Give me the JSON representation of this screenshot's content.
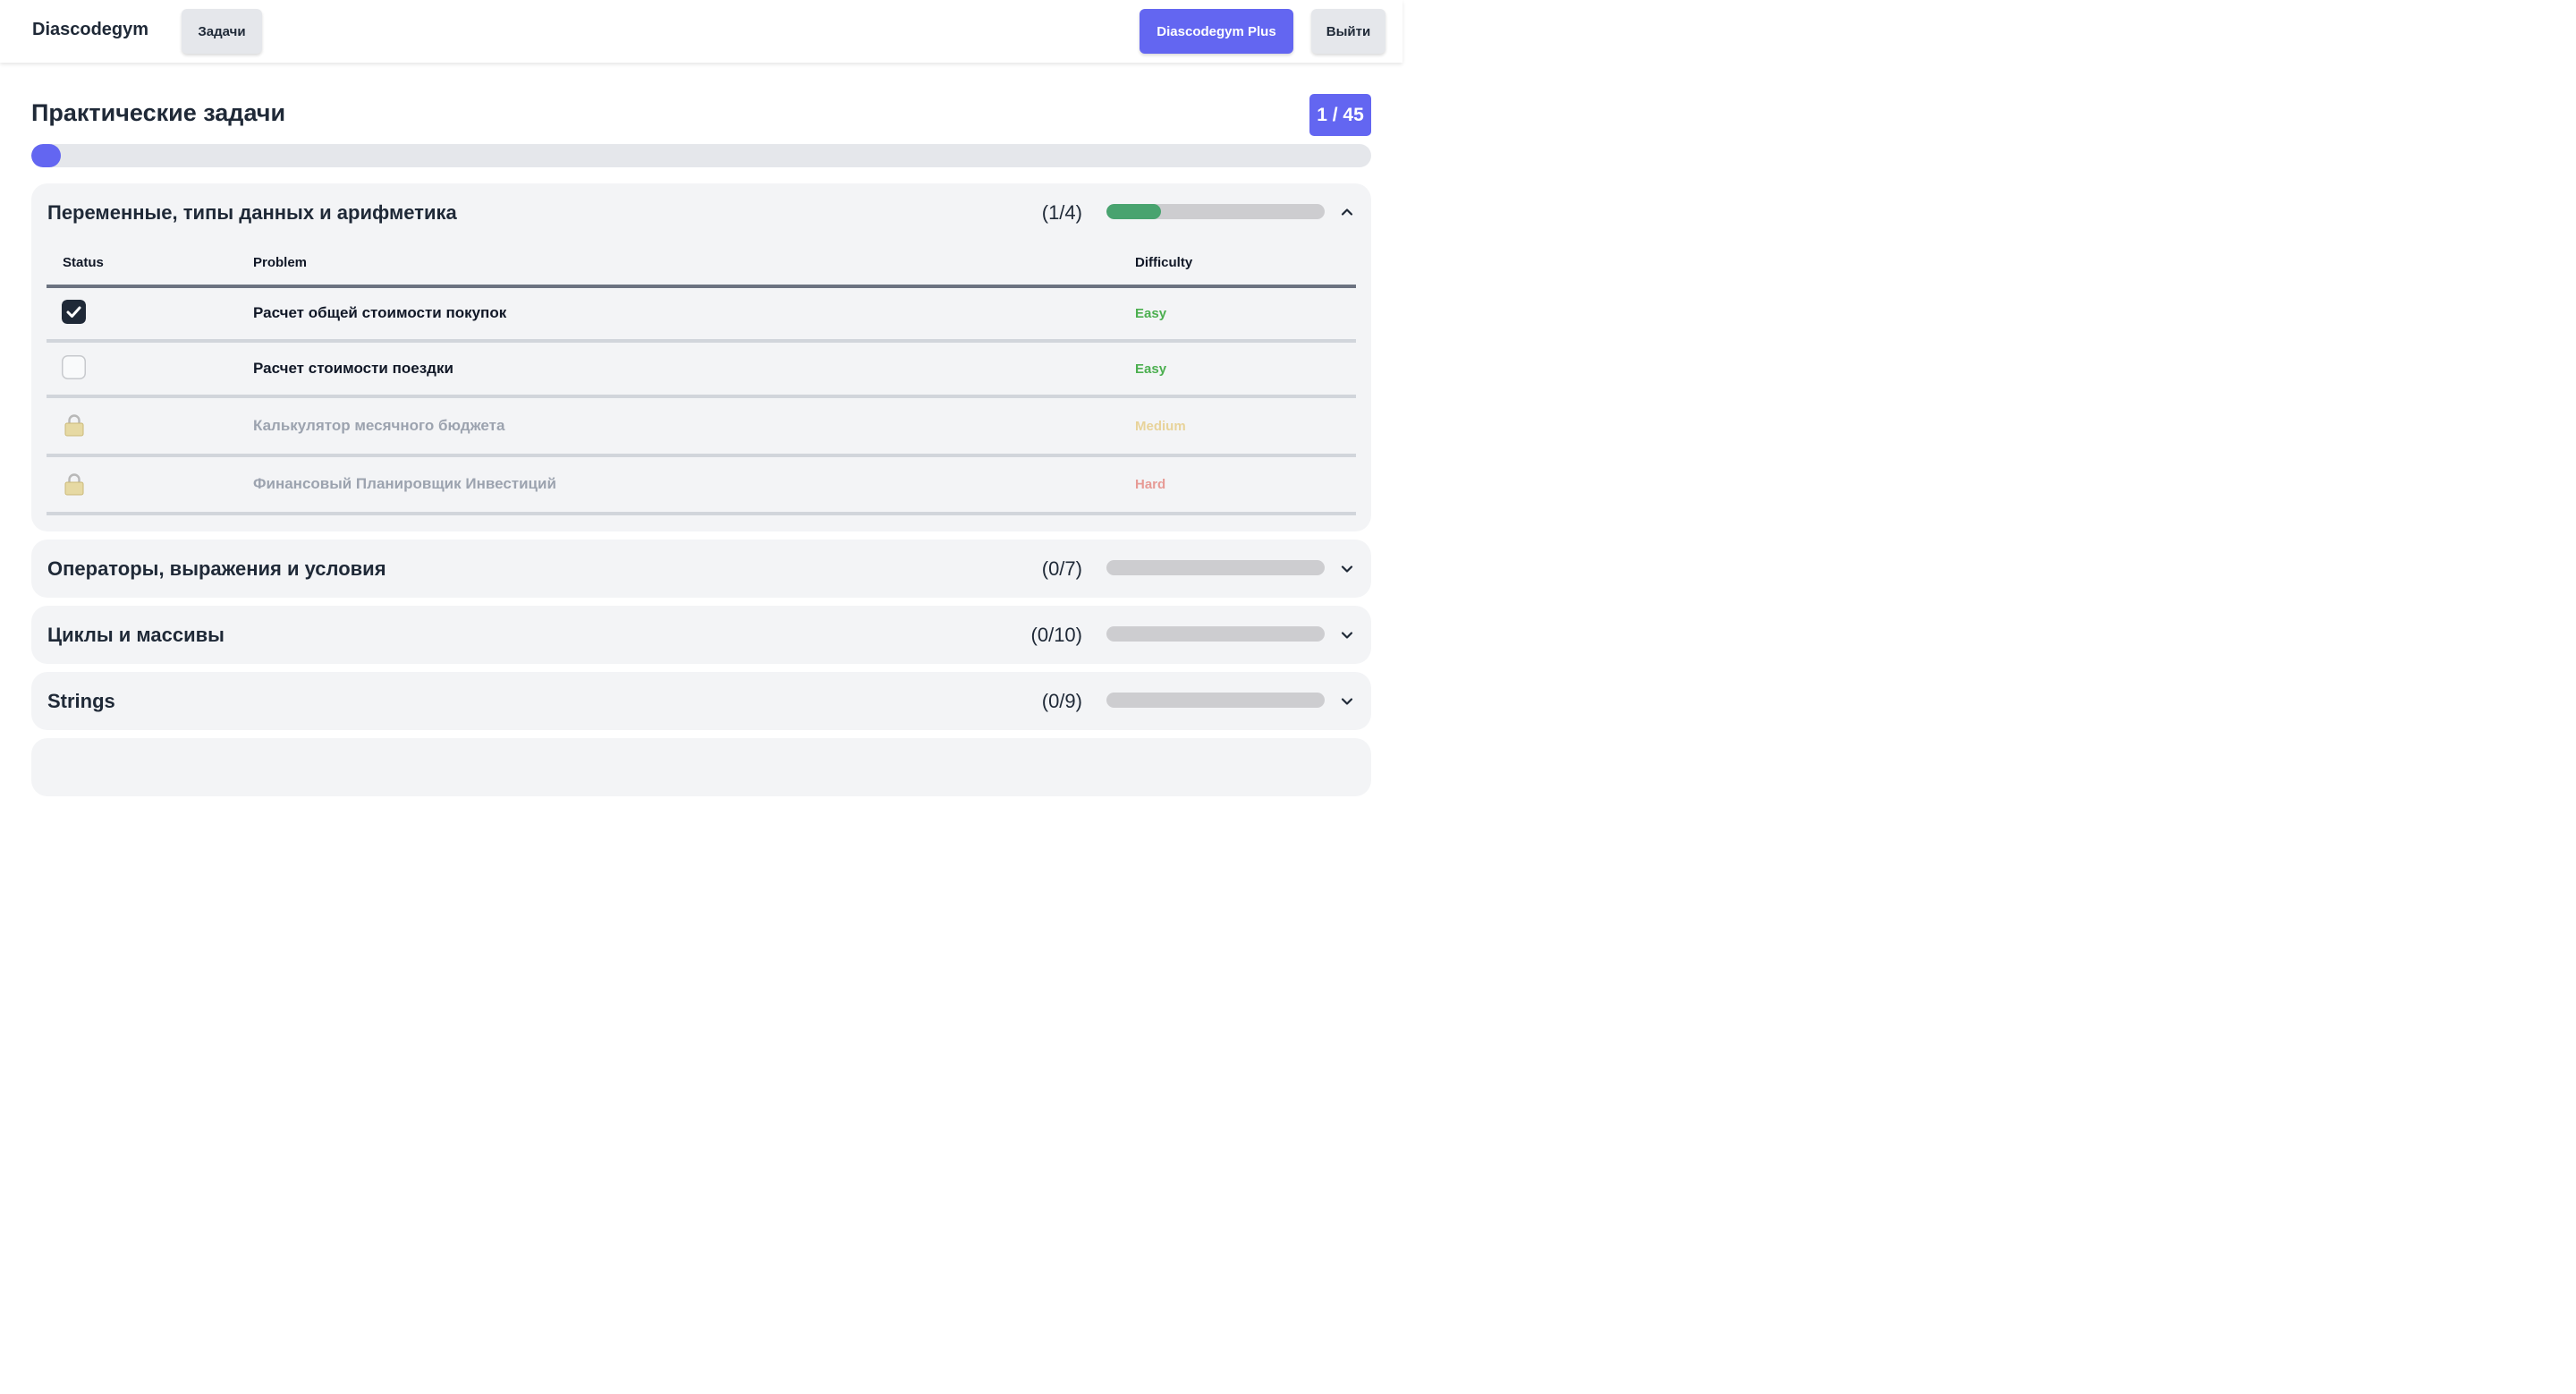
{
  "nav": {
    "brand": "Diascodegym",
    "tasks_label": "Задачи",
    "plus_label": "Diascodegym Plus",
    "logout_label": "Выйти"
  },
  "header": {
    "title": "Практические задачи",
    "counter": "1 / 45",
    "progress_fraction": 0.022
  },
  "table_headers": {
    "status": "Status",
    "problem": "Problem",
    "difficulty": "Difficulty"
  },
  "sections": [
    {
      "title": "Переменные, типы данных и арифметика",
      "count": "(1/4)",
      "progress_fraction": 0.25,
      "expanded": true,
      "problems": [
        {
          "status": "solved",
          "name": "Расчет общей стоимости покупок",
          "difficulty": "Easy"
        },
        {
          "status": "open",
          "name": "Расчет стоимости поездки",
          "difficulty": "Easy"
        },
        {
          "status": "locked",
          "name": "Калькулятор месячного бюджета",
          "difficulty": "Medium"
        },
        {
          "status": "locked",
          "name": "Финансовый Планировщик Инвестиций",
          "difficulty": "Hard"
        }
      ]
    },
    {
      "title": "Операторы, выражения и условия",
      "count": "(0/7)",
      "progress_fraction": 0,
      "expanded": false
    },
    {
      "title": "Циклы и массивы",
      "count": "(0/10)",
      "progress_fraction": 0,
      "expanded": false
    },
    {
      "title": "Strings",
      "count": "(0/9)",
      "progress_fraction": 0,
      "expanded": false
    }
  ],
  "colors": {
    "accent": "#6366f1",
    "progress_green": "#48a36f",
    "easy": "#4caf50",
    "medium": "#e8d39a",
    "hard": "#e79b96"
  },
  "icons": {
    "checked": "check-square-icon",
    "unchecked": "empty-checkbox-icon",
    "locked": "lock-icon",
    "expanded": "chevron-up-icon",
    "collapsed": "chevron-down-icon"
  }
}
